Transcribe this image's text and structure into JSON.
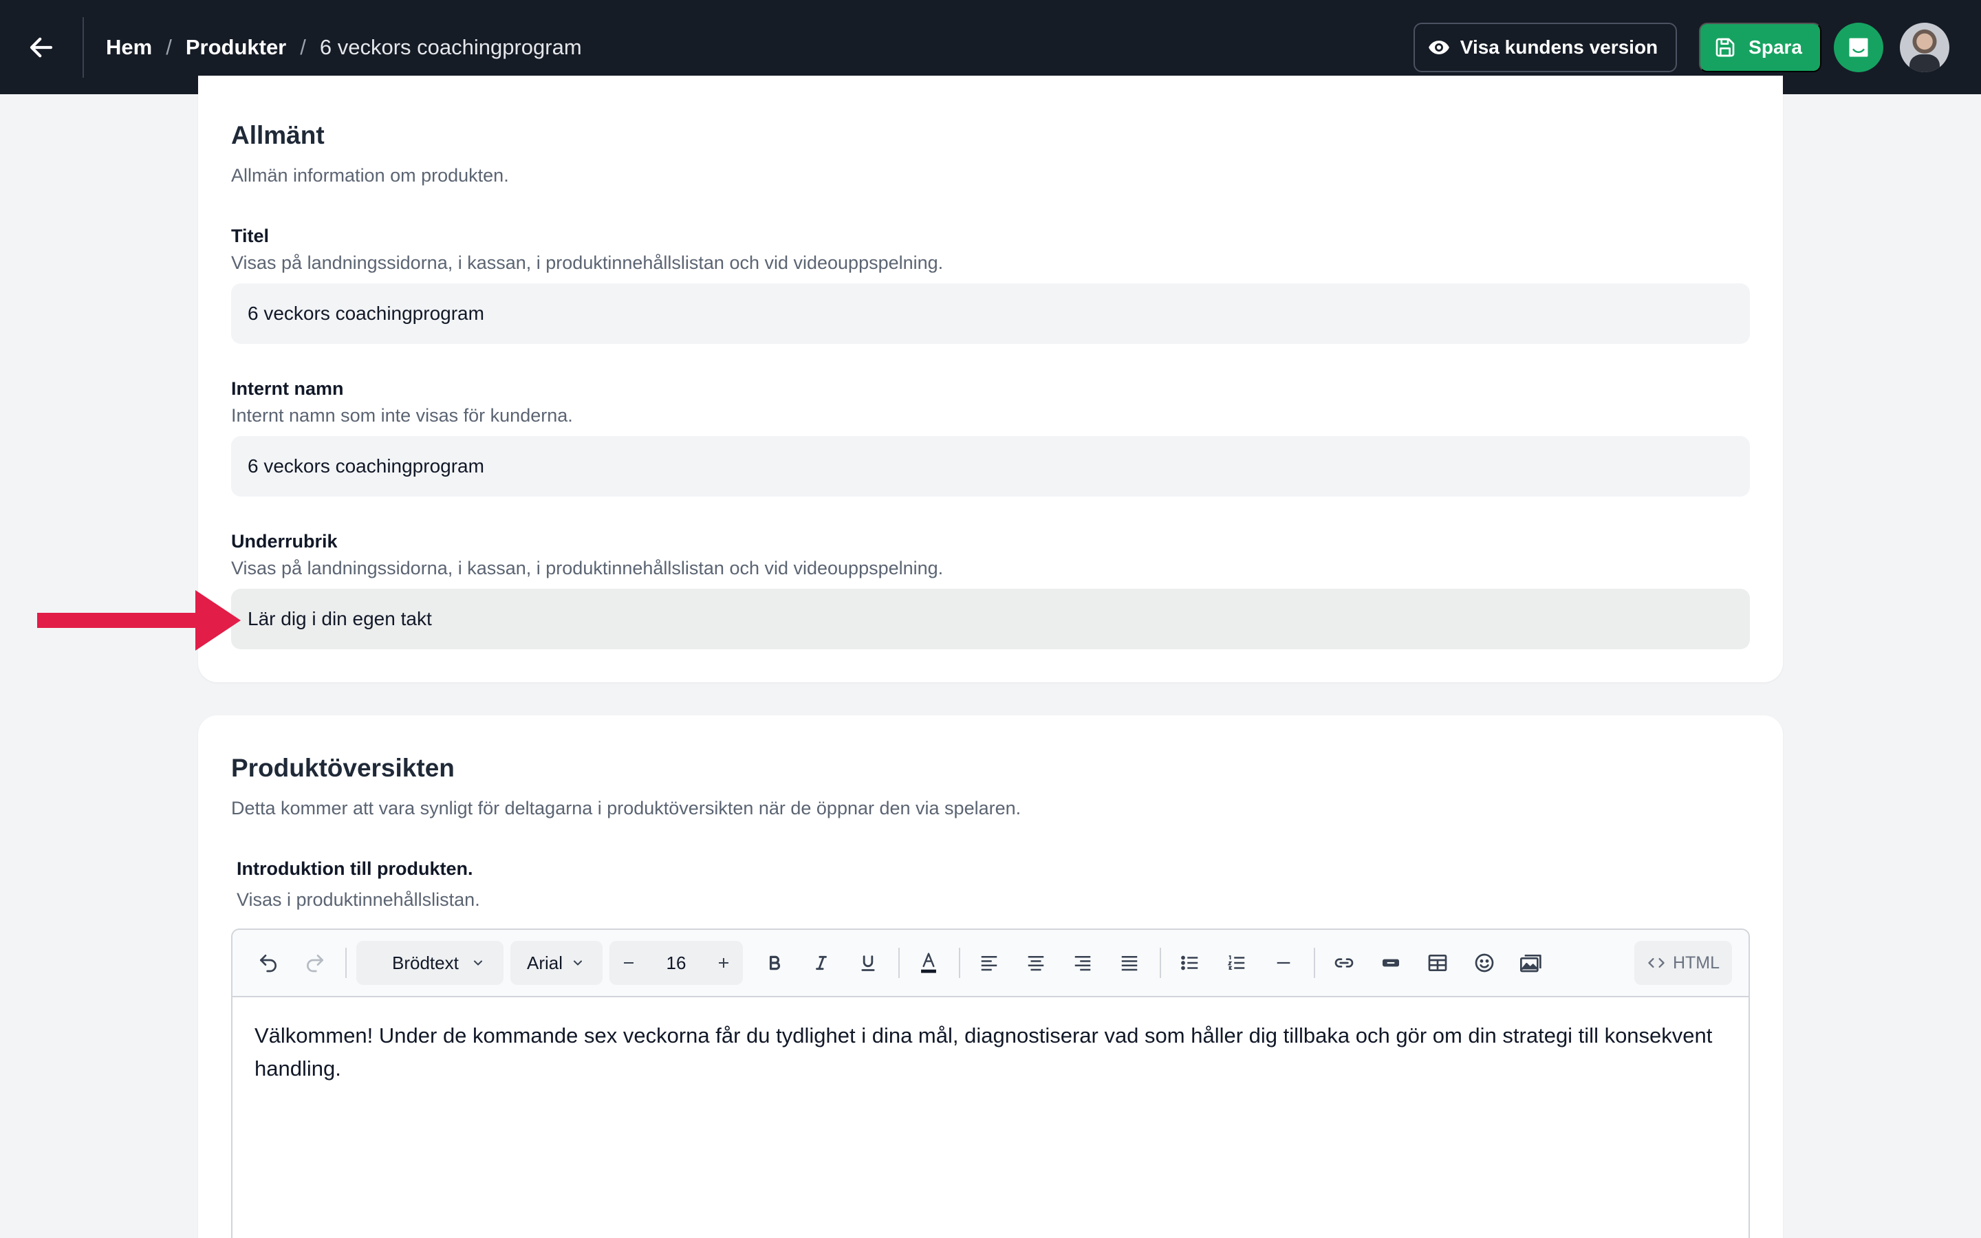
{
  "topbar": {
    "breadcrumb": {
      "home": "Hem",
      "products": "Produkter",
      "current": "6 veckors coachingprogram",
      "separator": "/"
    },
    "preview_label": "Visa kundens version",
    "save_label": "Spara"
  },
  "general": {
    "title": "Allmänt",
    "subtitle": "Allmän information om produkten.",
    "fields": {
      "title": {
        "label": "Titel",
        "help": "Visas på landningssidorna, i kassan, i produktinnehållslistan och vid videouppspelning.",
        "value": "6 veckors coachingprogram"
      },
      "internal_name": {
        "label": "Internt namn",
        "help": "Internt namn som inte visas för kunderna.",
        "value": "6 veckors coachingprogram"
      },
      "subheading": {
        "label": "Underrubrik",
        "help": "Visas på landningssidorna, i kassan, i produktinnehållslistan och vid videouppspelning.",
        "value": "Lär dig i din egen takt"
      }
    }
  },
  "overview": {
    "title": "Produktöversikten",
    "subtitle": "Detta kommer att vara synligt för deltagarna i produktöversikten när de öppnar den via spelaren.",
    "intro": {
      "label": "Introduktion till produkten.",
      "help": "Visas i produktinnehållslistan."
    },
    "editor": {
      "block_style": "Brödtext",
      "font": "Arial",
      "font_size": "16",
      "html_label": "HTML",
      "content": "Välkommen! Under de kommande sex veckorna får du tydlighet i dina mål, diagnostiserar vad som håller dig tillbaka och gör om din strategi till konsekvent handling."
    }
  },
  "colors": {
    "topbar_bg": "#161c26",
    "accent_green": "#16a361",
    "arrow_red": "#e11d48"
  },
  "icons": [
    "back-arrow-icon",
    "eye-icon",
    "save-icon",
    "chat-icon",
    "undo-icon",
    "redo-icon",
    "bold-icon",
    "italic-icon",
    "underline-icon",
    "text-color-icon",
    "align-left-icon",
    "align-center-icon",
    "align-right-icon",
    "align-justify-icon",
    "bullet-list-icon",
    "numbered-list-icon",
    "horizontal-rule-icon",
    "link-icon",
    "button-icon",
    "table-icon",
    "emoji-icon",
    "image-icon",
    "code-icon"
  ]
}
